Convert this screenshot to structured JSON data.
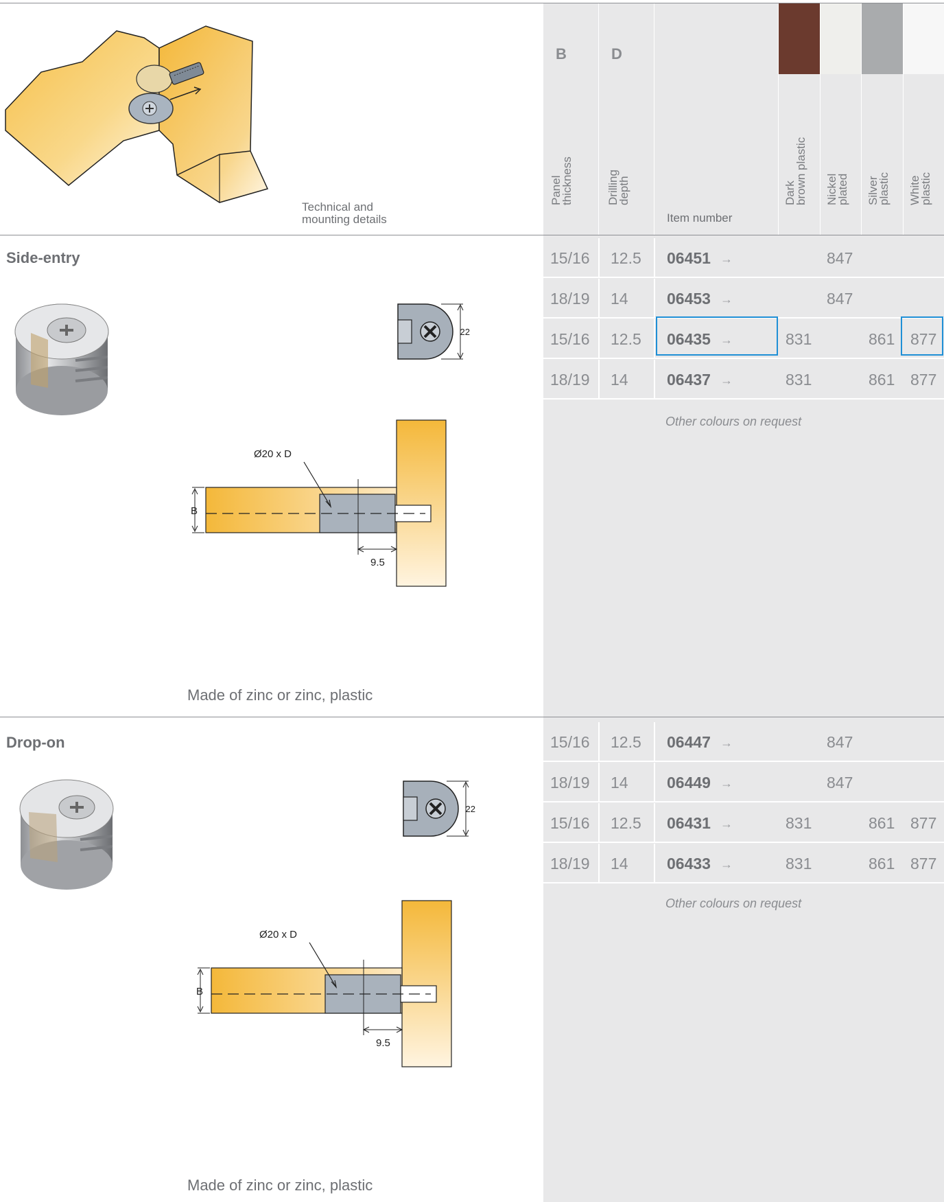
{
  "header": {
    "col_b_letter": "B",
    "col_d_letter": "D",
    "technical_details": "Technical and\nmounting details",
    "panel_thickness": "Panel\nthickness",
    "drilling_depth": "Drilling\ndepth",
    "item_number": "Item number",
    "colours": [
      {
        "label": "Dark\nbrown plastic",
        "swatch": "#6b3a2e"
      },
      {
        "label": "Nickel\nplated",
        "swatch": "#efefec"
      },
      {
        "label": "Silver\nplastic",
        "swatch": "#a9abad"
      },
      {
        "label": "White\nplastic",
        "swatch": "#f7f7f7"
      }
    ]
  },
  "sections": [
    {
      "title": "Side-entry",
      "material": "Made of zinc or zinc, plastic",
      "note": "Other colours on request",
      "drawing": {
        "hole_label": "Ø20 x D",
        "b_label": "B",
        "offset_label": "9.5",
        "height_label": "22"
      },
      "rows": [
        {
          "b": "15/16",
          "d": "12.5",
          "item": "06451",
          "dark_brown": "",
          "nickel": "847",
          "silver": "",
          "white": ""
        },
        {
          "b": "18/19",
          "d": "14",
          "item": "06453",
          "dark_brown": "",
          "nickel": "847",
          "silver": "",
          "white": ""
        },
        {
          "b": "15/16",
          "d": "12.5",
          "item": "06435",
          "dark_brown": "831",
          "nickel": "",
          "silver": "861",
          "white": "877"
        },
        {
          "b": "18/19",
          "d": "14",
          "item": "06437",
          "dark_brown": "831",
          "nickel": "",
          "silver": "861",
          "white": "877"
        }
      ]
    },
    {
      "title": "Drop-on",
      "material": "Made of zinc or zinc, plastic",
      "note": "Other colours on request",
      "drawing": {
        "hole_label": "Ø20 x D",
        "b_label": "B",
        "offset_label": "9.5",
        "height_label": "22"
      },
      "rows": [
        {
          "b": "15/16",
          "d": "12.5",
          "item": "06447",
          "dark_brown": "",
          "nickel": "847",
          "silver": "",
          "white": ""
        },
        {
          "b": "18/19",
          "d": "14",
          "item": "06449",
          "dark_brown": "",
          "nickel": "847",
          "silver": "",
          "white": ""
        },
        {
          "b": "15/16",
          "d": "12.5",
          "item": "06431",
          "dark_brown": "831",
          "nickel": "",
          "silver": "861",
          "white": "877"
        },
        {
          "b": "18/19",
          "d": "14",
          "item": "06433",
          "dark_brown": "831",
          "nickel": "",
          "silver": "861",
          "white": "877"
        }
      ]
    }
  ],
  "row_arrow": "→",
  "highlight_color": "#1f8fd6"
}
